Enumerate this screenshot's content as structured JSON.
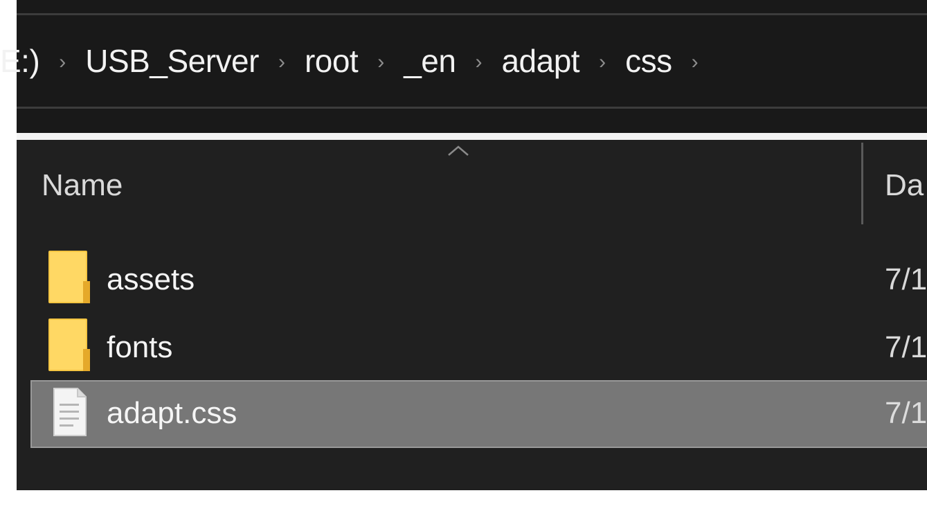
{
  "breadcrumb": {
    "items": [
      {
        "label": "E:)"
      },
      {
        "label": "USB_Server"
      },
      {
        "label": "root"
      },
      {
        "label": "_en"
      },
      {
        "label": "adapt"
      },
      {
        "label": "css"
      }
    ],
    "separator": "›"
  },
  "columns": {
    "name": "Name",
    "date": "Da"
  },
  "files": [
    {
      "name": "assets",
      "date": "7/1",
      "type": "folder",
      "icon": "folder-icon",
      "selected": false
    },
    {
      "name": "fonts",
      "date": "7/1",
      "type": "folder",
      "icon": "folder-icon",
      "selected": false
    },
    {
      "name": "adapt.css",
      "date": "7/1",
      "type": "file",
      "icon": "file-icon",
      "selected": true
    }
  ],
  "colors": {
    "background": "#202020",
    "address_bar": "#191919",
    "selected_row": "#777777",
    "folder_yellow": "#ffd75e",
    "text": "#f5f5f5"
  }
}
